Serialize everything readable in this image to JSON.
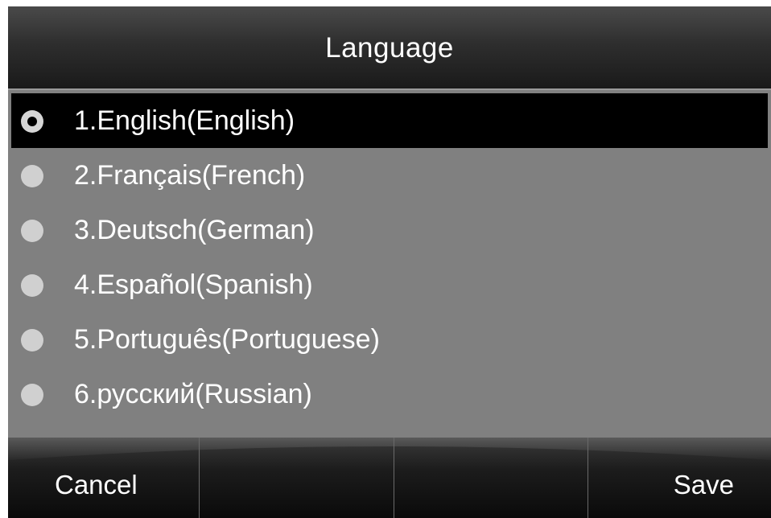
{
  "header": {
    "title": "Language"
  },
  "languages": [
    {
      "label": "1.English(English)",
      "selected": true
    },
    {
      "label": "2.Français(French)",
      "selected": false
    },
    {
      "label": "3.Deutsch(German)",
      "selected": false
    },
    {
      "label": "4.Español(Spanish)",
      "selected": false
    },
    {
      "label": "5.Português(Portuguese)",
      "selected": false
    },
    {
      "label": "6.русский(Russian)",
      "selected": false
    }
  ],
  "softkeys": [
    {
      "label": "Cancel"
    },
    {
      "label": ""
    },
    {
      "label": ""
    },
    {
      "label": "Save"
    }
  ],
  "colors": {
    "background": "#808080",
    "selected_row": "#000000",
    "text": "#ffffff"
  }
}
